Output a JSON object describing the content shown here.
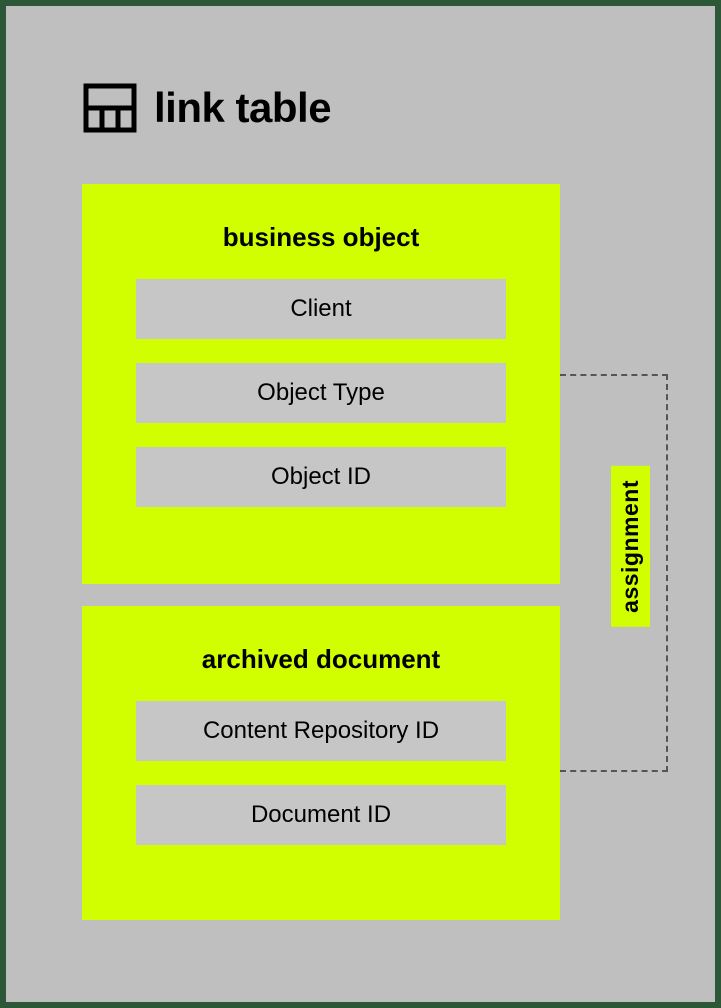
{
  "title": "link table",
  "blocks": {
    "business_object": {
      "title": "business object",
      "fields": [
        "Client",
        "Object Type",
        "Object ID"
      ]
    },
    "archived_document": {
      "title": "archived document",
      "fields": [
        "Content Repository ID",
        "Document ID"
      ]
    }
  },
  "connector_label": "assignment"
}
